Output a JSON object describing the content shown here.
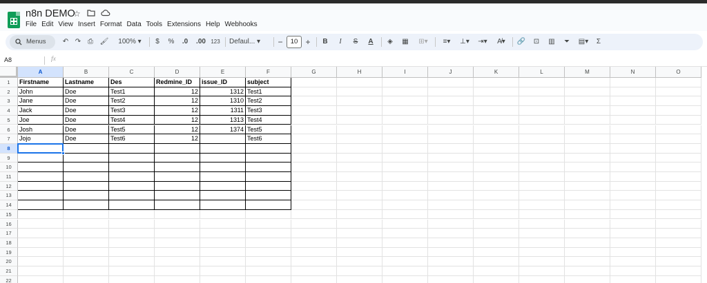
{
  "app": {
    "doc_title": "n8n DEMO",
    "menu": [
      "File",
      "Edit",
      "View",
      "Insert",
      "Format",
      "Data",
      "Tools",
      "Extensions",
      "Help",
      "Webhooks"
    ]
  },
  "toolbar": {
    "search_label": "Menus",
    "zoom": "100%",
    "currency": "$",
    "percent": "%",
    "dec_decrease": ".0",
    "dec_increase": ".00",
    "num_format": "123",
    "font": "Defaul...",
    "font_size": "10",
    "minus": "−",
    "plus": "+",
    "bold": "B",
    "italic": "I",
    "strike": "S",
    "text_color": "A",
    "sigma": "Σ"
  },
  "formula_bar": {
    "name_box": "A8",
    "fx": "fx",
    "value": ""
  },
  "sheet": {
    "columns": [
      "A",
      "B",
      "C",
      "D",
      "E",
      "F",
      "G",
      "H",
      "I",
      "J",
      "K",
      "L",
      "M",
      "N",
      "O"
    ],
    "rows": [
      "1",
      "2",
      "3",
      "4",
      "5",
      "6",
      "7",
      "8",
      "9",
      "10",
      "11",
      "12",
      "13",
      "14",
      "15",
      "16",
      "17",
      "18",
      "19",
      "20",
      "21",
      "22"
    ],
    "selected_cell": "A8",
    "headers": [
      "Firstname",
      "Lastname",
      "Des",
      "Redmine_ID",
      "issue_ID",
      "subject"
    ],
    "data": [
      [
        "John",
        "Doe",
        "Test1",
        "12",
        "1312",
        "Test1"
      ],
      [
        "Jane",
        "Doe",
        "Test2",
        "12",
        "1310",
        "Test2"
      ],
      [
        "Jack",
        "Doe",
        "Test3",
        "12",
        "1311",
        "Test3"
      ],
      [
        "Joe",
        "Doe",
        "Test4",
        "12",
        "1313",
        "Test4"
      ],
      [
        "Josh",
        "Doe",
        "Test5",
        "12",
        "1374",
        "Test5"
      ],
      [
        "Jojo",
        "Doe",
        "Test6",
        "12",
        "",
        "Test6"
      ]
    ],
    "numeric_columns": [
      3,
      4
    ]
  }
}
